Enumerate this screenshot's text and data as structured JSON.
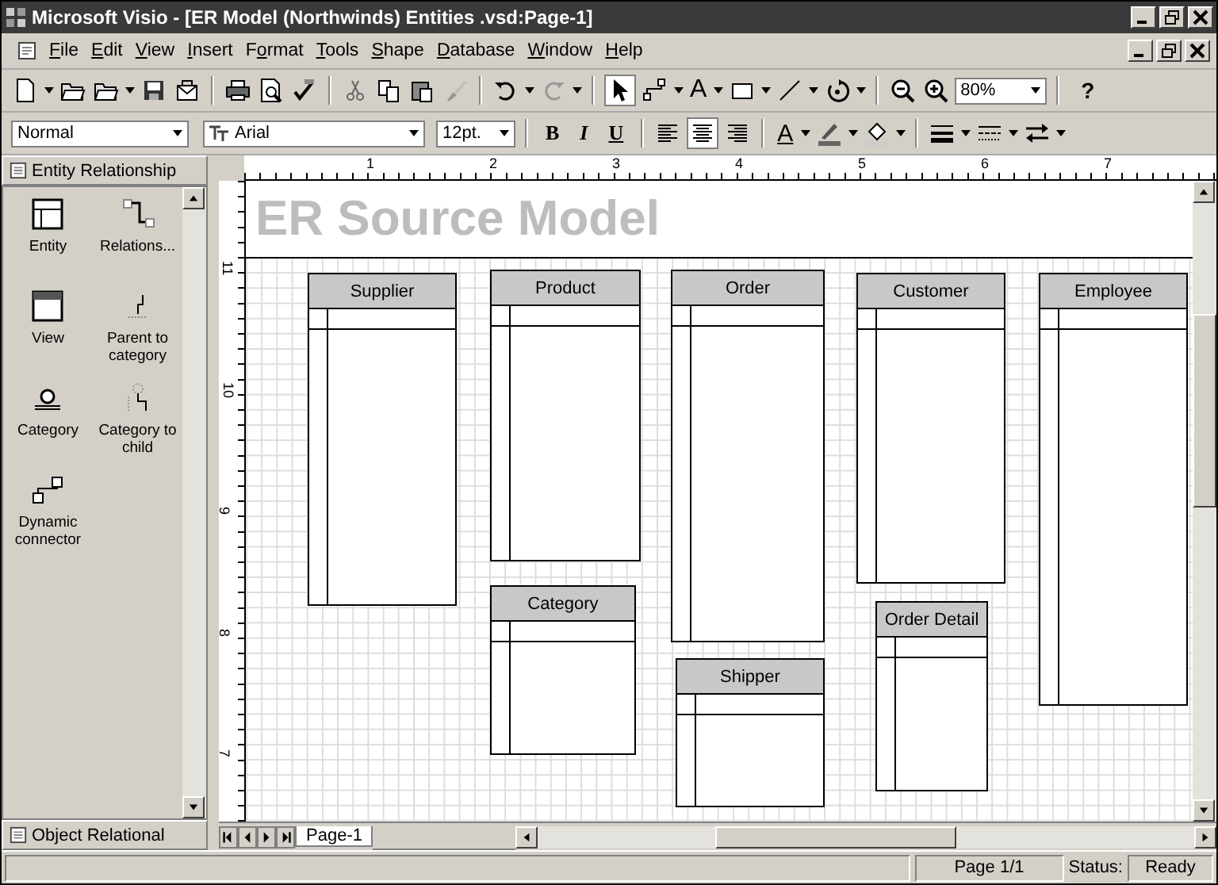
{
  "window": {
    "title": "Microsoft Visio - [ER Model (Northwinds) Entities .vsd:Page-1]"
  },
  "menu": [
    {
      "label": "File"
    },
    {
      "label": "Edit"
    },
    {
      "label": "View"
    },
    {
      "label": "Insert"
    },
    {
      "label": "Format"
    },
    {
      "label": "Tools"
    },
    {
      "label": "Shape"
    },
    {
      "label": "Database"
    },
    {
      "label": "Window"
    },
    {
      "label": "Help"
    }
  ],
  "standard_toolbar": {
    "text_tool": "A",
    "zoom": "80%",
    "help": "?"
  },
  "format_toolbar": {
    "style": "Normal",
    "font": "Arial",
    "size": "12pt.",
    "bold": "B",
    "italic": "I",
    "underline": "U",
    "font_color": "A"
  },
  "stencil": {
    "title": "Entity Relationship",
    "footer": "Object Relational",
    "items": [
      {
        "label": "Entity",
        "kind": "entity"
      },
      {
        "label": "Relations...",
        "kind": "relationship"
      },
      {
        "label": "View",
        "kind": "view"
      },
      {
        "label": "Parent to category",
        "kind": "parent"
      },
      {
        "label": "Category",
        "kind": "category"
      },
      {
        "label": "Category to child",
        "kind": "child"
      },
      {
        "label": "Dynamic connector",
        "kind": "connector"
      }
    ]
  },
  "ruler": {
    "horizontal": [
      "1",
      "2",
      "3",
      "4",
      "5",
      "6",
      "7"
    ],
    "vertical": [
      "11",
      "10",
      "9",
      "8",
      "7"
    ]
  },
  "drawing": {
    "title": "ER Source Model",
    "entities": [
      {
        "name": "Supplier"
      },
      {
        "name": "Product"
      },
      {
        "name": "Order"
      },
      {
        "name": "Customer"
      },
      {
        "name": "Employee"
      },
      {
        "name": "Category"
      },
      {
        "name": "Order Detail"
      },
      {
        "name": "Shipper"
      }
    ]
  },
  "page_tabs": [
    {
      "label": "Page-1",
      "selected": true
    }
  ],
  "status_bar": {
    "page": "Page 1/1",
    "status_label": "Status:",
    "status": "Ready"
  }
}
